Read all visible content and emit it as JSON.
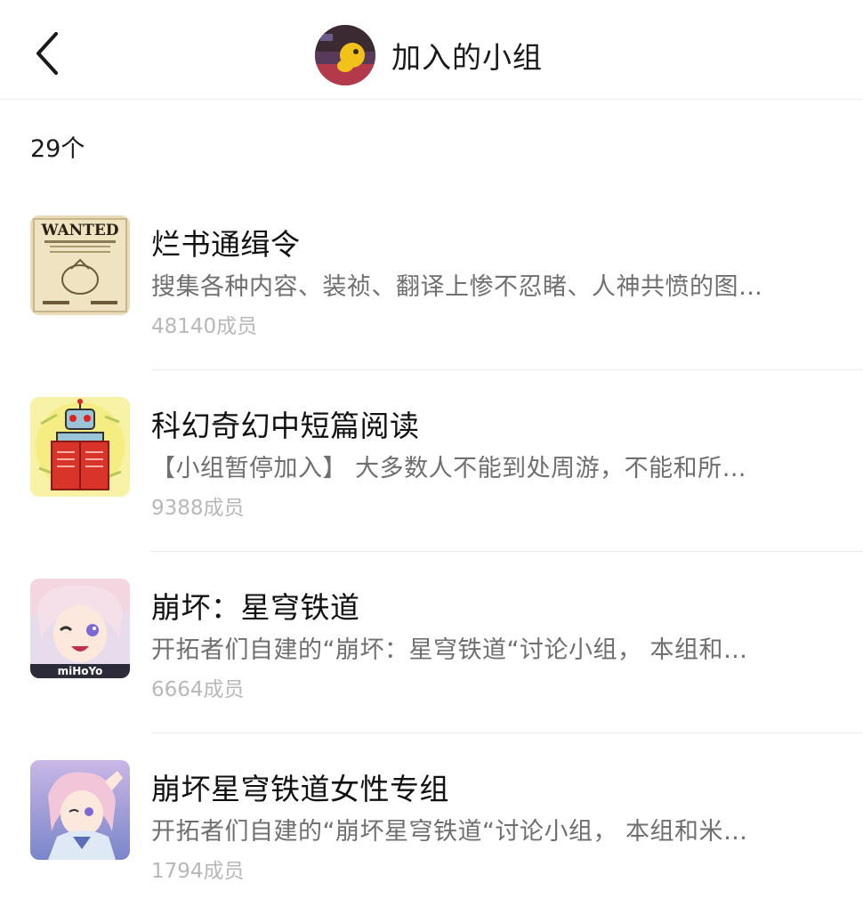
{
  "header": {
    "title": "加入的小组"
  },
  "summary": {
    "count": "29个"
  },
  "groups": [
    {
      "name": "烂书通缉令",
      "desc": "搜集各种内容、装祯、翻译上惨不忍睹、人神共愤的图…",
      "members": "48140成员",
      "thumb_text": "WANTED"
    },
    {
      "name": "科幻奇幻中短篇阅读",
      "desc": "【小组暂停加入】 大多数人不能到处周游，不能和所…",
      "members": "9388成员"
    },
    {
      "name": "崩坏：星穹铁道",
      "desc": "开拓者们自建的“崩坏：星穹铁道“讨论小组， 本组和…",
      "members": "6664成员",
      "thumb_text": "miHoYo"
    },
    {
      "name": "崩坏星穹铁道女性专组",
      "desc": "开拓者们自建的“崩坏星穹铁道“讨论小组， 本组和米…",
      "members": "1794成员"
    }
  ],
  "colors": {
    "text_primary": "#111111",
    "text_secondary": "#6f6f6f",
    "text_tertiary": "#b8b8b8",
    "divider": "#ebebeb"
  },
  "icons": {
    "back": "chevron-left-icon"
  }
}
